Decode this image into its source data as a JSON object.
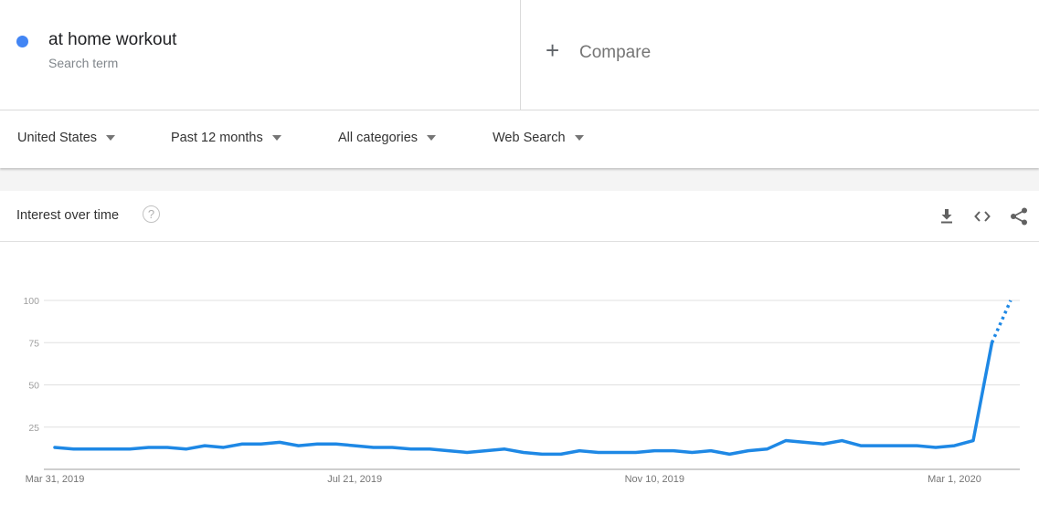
{
  "search_term": {
    "name": "at home workout",
    "type": "Search term",
    "color": "#4285f4"
  },
  "compare": {
    "icon": "plus-icon",
    "label": "Compare"
  },
  "filters": [
    {
      "label": "United States"
    },
    {
      "label": "Past 12 months"
    },
    {
      "label": "All categories"
    },
    {
      "label": "Web Search"
    }
  ],
  "card": {
    "title": "Interest over time",
    "help_icon": "?",
    "actions": [
      "download-icon",
      "embed-icon",
      "share-icon"
    ]
  },
  "chart_data": {
    "type": "line",
    "title": "Interest over time",
    "xlabel": "",
    "ylabel": "",
    "ylim": [
      0,
      100
    ],
    "yticks": [
      25,
      50,
      75,
      100
    ],
    "xtick_labels": [
      {
        "label": "Mar 31, 2019",
        "index": 0
      },
      {
        "label": "Jul 21, 2019",
        "index": 16
      },
      {
        "label": "Nov 10, 2019",
        "index": 32
      },
      {
        "label": "Mar 1, 2020",
        "index": 48
      }
    ],
    "grid": true,
    "legend": "none",
    "series": [
      {
        "name": "at home workout",
        "color": "#1e88e5",
        "values": [
          13,
          12,
          12,
          12,
          12,
          13,
          13,
          12,
          14,
          13,
          15,
          15,
          16,
          14,
          15,
          15,
          14,
          13,
          13,
          12,
          12,
          11,
          10,
          11,
          12,
          10,
          9,
          9,
          11,
          10,
          10,
          10,
          11,
          11,
          10,
          11,
          9,
          11,
          12,
          17,
          16,
          15,
          17,
          14,
          14,
          14,
          14,
          13,
          14,
          17,
          75,
          100
        ],
        "partial_from_index": 50
      }
    ]
  }
}
